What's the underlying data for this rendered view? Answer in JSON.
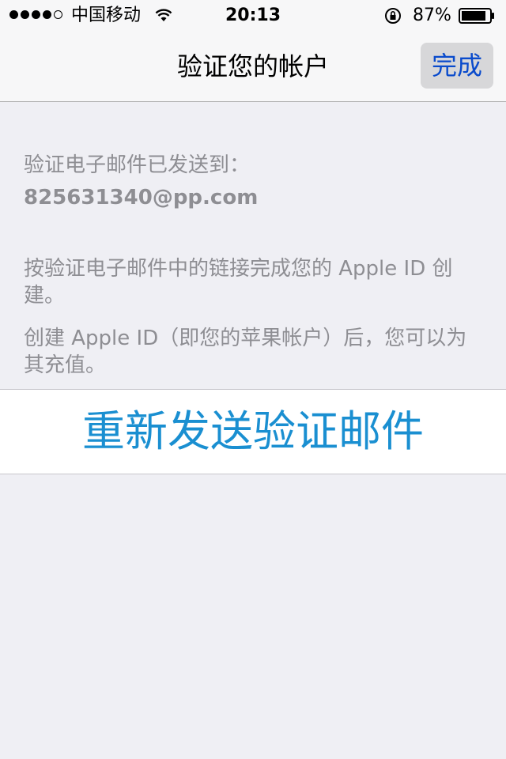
{
  "status_bar": {
    "carrier": "中国移动",
    "time": "20:13",
    "battery_percent": "87%"
  },
  "nav": {
    "title": "验证您的帐户",
    "done_label": "完成"
  },
  "content": {
    "sent_label": "验证电子邮件已发送到：",
    "email": "825631340@pp.com",
    "instruction": "按验证电子邮件中的链接完成您的 Apple ID 创建。",
    "note": "创建 Apple ID（即您的苹果帐户）后，您可以为其充值。"
  },
  "resend": {
    "label": "重新发送验证邮件"
  },
  "colors": {
    "accent": "#1a8fd1",
    "done_text": "#0a4bcc",
    "background": "#efeff4",
    "secondary_text": "#8e8e93"
  }
}
